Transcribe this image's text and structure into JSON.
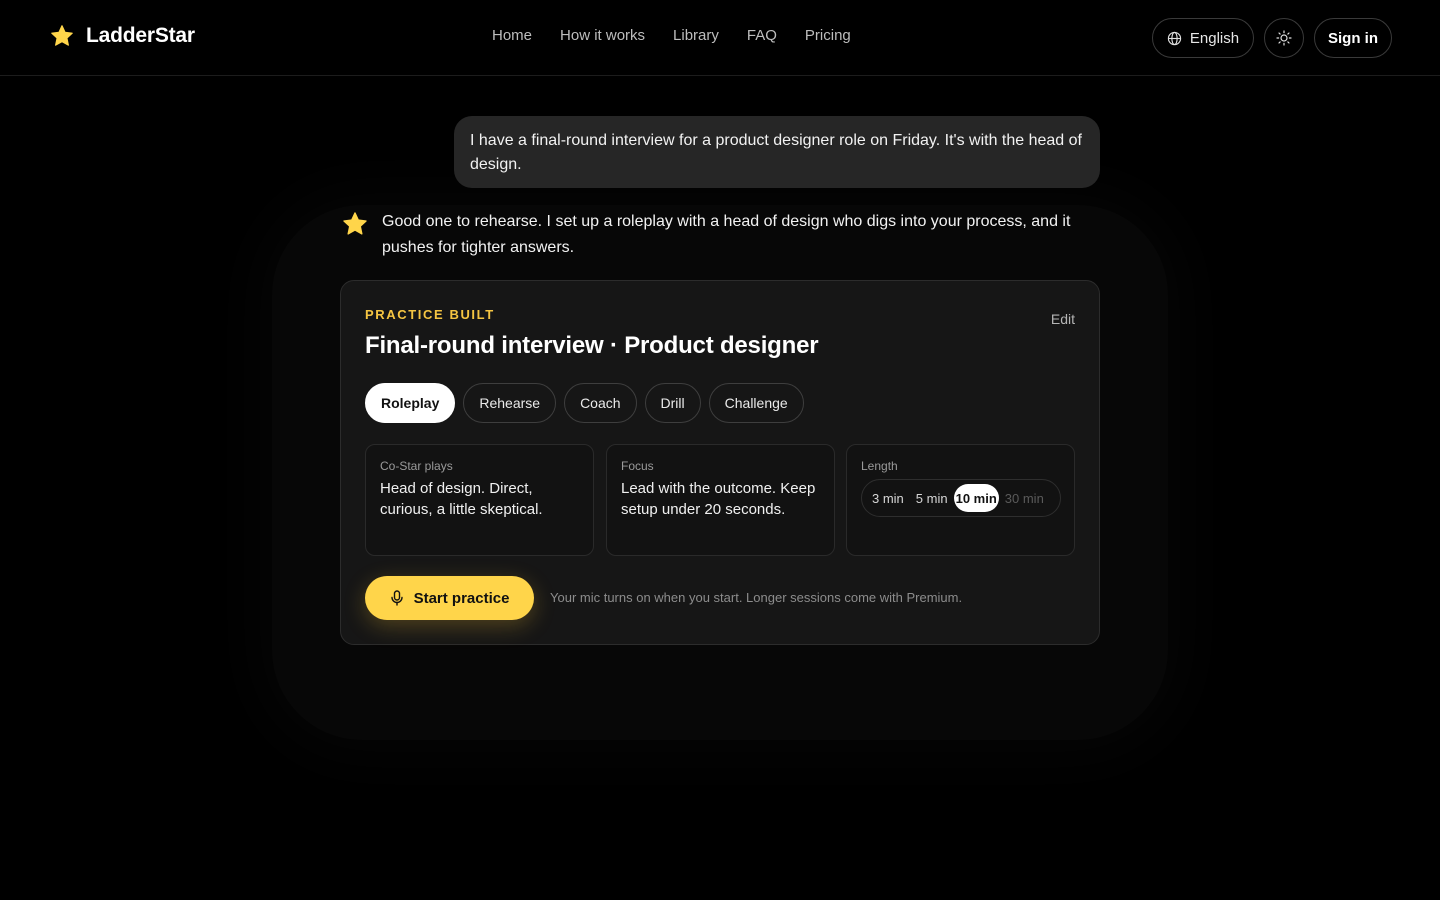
{
  "header": {
    "brand": "LadderStar",
    "nav": [
      "Home",
      "How it works",
      "Library",
      "FAQ",
      "Pricing"
    ],
    "language": "English",
    "theme_icon": "sun-icon",
    "sign_in": "Sign in"
  },
  "chat": {
    "user_message": "I have a final-round interview for a product designer role on Friday. It's with the head of design.",
    "assistant_message": "Good one to rehearse. I set up a roleplay with a head of design who digs into your process, and it pushes for tighter answers."
  },
  "card": {
    "eyebrow": "PRACTICE BUILT",
    "edit": "Edit",
    "title": "Final-round interview · Product designer",
    "modes": [
      "Roleplay",
      "Rehearse",
      "Coach",
      "Drill",
      "Challenge"
    ],
    "active_mode": "Roleplay",
    "costar_label": "Co-Star plays",
    "costar_value": "Head of design. Direct, curious, a little skeptical.",
    "focus_label": "Focus",
    "focus_value": "Lead with the outcome. Keep setup under 20 seconds.",
    "length_label": "Length",
    "length_options": [
      "3 min",
      "5 min",
      "10 min",
      "30 min"
    ],
    "length_selected": "10 min",
    "length_locked": "30 min",
    "start_label": "Start practice",
    "start_note": "Your mic turns on when you start. Longer sessions come with Premium."
  },
  "colors": {
    "accent": "#ffd54a",
    "eyebrow": "#f5c542",
    "background": "#000000",
    "card": "#161616"
  }
}
